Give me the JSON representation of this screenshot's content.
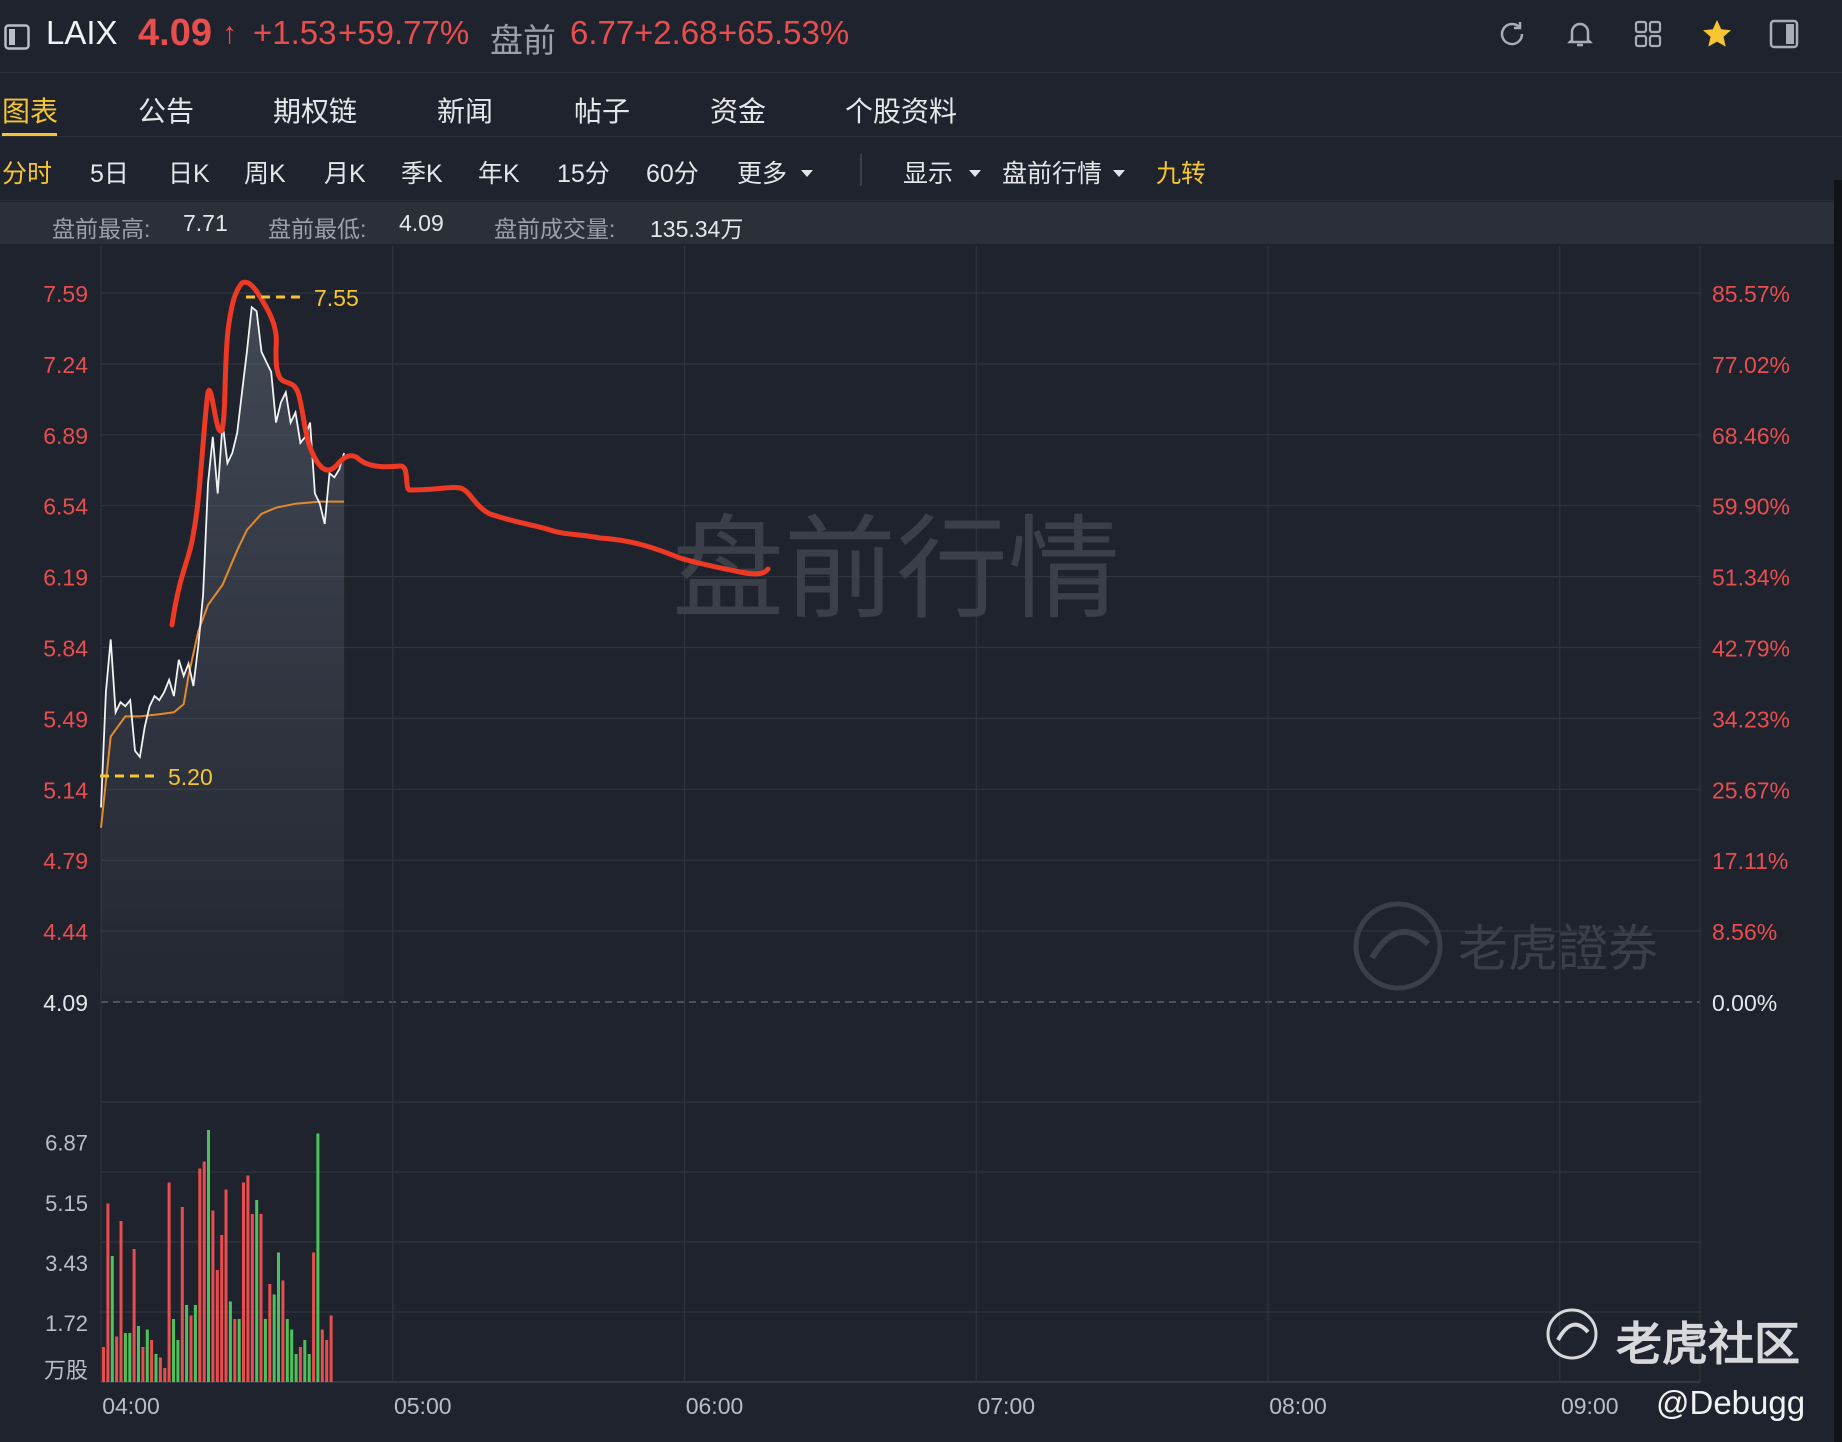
{
  "header": {
    "ticker": "LAIX",
    "price": "4.09",
    "arrow": "↑",
    "change": "+1.53",
    "change_pct": "+59.77%",
    "premarket_label": "盘前",
    "premarket_price": "6.77",
    "premarket_change": "+2.68",
    "premarket_change_pct": "+65.53%"
  },
  "tabs": [
    "图表",
    "公告",
    "期权链",
    "新闻",
    "帖子",
    "资金",
    "个股资料"
  ],
  "periods": [
    "分时",
    "5日",
    "日K",
    "周K",
    "月K",
    "季K",
    "年K",
    "15分",
    "60分",
    "更多"
  ],
  "tools": {
    "display": "显示",
    "premarket": "盘前行情",
    "nine_turn": "九转"
  },
  "stats": {
    "high_label": "盘前最高:",
    "high": "7.71",
    "low_label": "盘前最低:",
    "low": "4.09",
    "volume_label": "盘前成交量:",
    "volume": "135.34万"
  },
  "watermark": "盘前行情",
  "brand_watermark": "老虎證券",
  "community": "老虎社区",
  "credit": "@Debugg",
  "annotations": {
    "high_marker": "7.55",
    "low_marker": "5.20"
  },
  "colors": {
    "up": "#e84e4e",
    "down": "#4cc35a",
    "accent": "#f5c533",
    "avg_line": "#e48a2e",
    "annotation": "#ee3a25"
  },
  "chart_data": [
    {
      "type": "line",
      "y_ticks_left": [
        "7.59",
        "7.24",
        "6.89",
        "6.54",
        "6.19",
        "5.84",
        "5.49",
        "5.14",
        "4.79",
        "4.44",
        "4.09"
      ],
      "y_ticks_right": [
        "85.57%",
        "77.02%",
        "68.46%",
        "59.90%",
        "51.34%",
        "42.79%",
        "34.23%",
        "25.67%",
        "17.11%",
        "8.56%",
        "0.00%"
      ],
      "x_ticks": [
        "04:00",
        "05:00",
        "06:00",
        "07:00",
        "08:00",
        "09:00"
      ],
      "ylim": [
        4.09,
        7.59
      ],
      "base_price": 4.09,
      "series": [
        {
          "x": [
            "04:00",
            "04:01",
            "04:02",
            "04:03",
            "04:04",
            "04:05",
            "04:06",
            "04:07",
            "04:08",
            "04:09",
            "04:10",
            "04:11",
            "04:12",
            "04:13",
            "04:14",
            "04:15",
            "04:16",
            "04:17",
            "04:18",
            "04:19",
            "04:20",
            "04:21",
            "04:22",
            "04:23",
            "04:24",
            "04:25",
            "04:26",
            "04:27",
            "04:28",
            "04:29",
            "04:30",
            "04:31",
            "04:32",
            "04:33",
            "04:34",
            "04:35",
            "04:36",
            "04:37",
            "04:38",
            "04:39",
            "04:40",
            "04:41",
            "04:42",
            "04:43",
            "04:44",
            "04:45",
            "04:46",
            "04:47",
            "04:48",
            "04:49",
            "04:50"
          ],
          "values": [
            5.05,
            5.62,
            5.88,
            5.52,
            5.57,
            5.55,
            5.58,
            5.33,
            5.3,
            5.45,
            5.55,
            5.6,
            5.58,
            5.62,
            5.68,
            5.6,
            5.78,
            5.7,
            5.76,
            5.65,
            5.85,
            6.1,
            6.65,
            6.88,
            6.6,
            6.95,
            6.75,
            6.8,
            6.9,
            7.1,
            7.3,
            7.52,
            7.5,
            7.3,
            7.25,
            7.2,
            6.95,
            7.05,
            7.1,
            6.95,
            7.0,
            6.85,
            6.88,
            6.95,
            6.6,
            6.55,
            6.45,
            6.7,
            6.68,
            6.72,
            6.8
          ]
        },
        {
          "x": [
            "04:00",
            "04:02",
            "04:05",
            "04:08",
            "04:12",
            "04:15",
            "04:17",
            "04:18",
            "04:20",
            "04:22",
            "04:25",
            "04:28",
            "04:30",
            "04:33",
            "04:36",
            "04:40",
            "04:45",
            "04:50"
          ],
          "values": [
            4.95,
            5.4,
            5.5,
            5.5,
            5.51,
            5.52,
            5.56,
            5.7,
            5.92,
            6.05,
            6.15,
            6.32,
            6.42,
            6.5,
            6.53,
            6.55,
            6.56,
            6.56
          ]
        }
      ]
    },
    {
      "type": "bar",
      "y_ticks": [
        "6.87",
        "5.15",
        "3.43",
        "1.72"
      ],
      "unit": "万股",
      "ylim": [
        0,
        8.0
      ],
      "x_start": "04:00",
      "values": [
        1.0,
        5.1,
        3.6,
        1.3,
        4.6,
        1.4,
        1.4,
        3.8,
        1.6,
        1.0,
        1.5,
        1.2,
        0.8,
        0.7,
        0.4,
        5.7,
        1.8,
        1.2,
        5.0,
        2.2,
        1.9,
        2.2,
        6.1,
        6.3,
        7.2,
        4.9,
        3.2,
        4.2,
        5.5,
        2.3,
        1.8,
        1.8,
        5.7,
        5.9,
        4.8,
        5.2,
        4.8,
        1.8,
        2.8,
        2.5,
        3.7,
        2.9,
        1.8,
        1.5,
        0.8,
        1.0,
        1.2,
        0.8,
        3.7,
        7.1,
        1.5,
        1.2,
        1.9
      ],
      "colors_up_down": [
        "up",
        "up",
        "down",
        "up",
        "up",
        "down",
        "down",
        "up",
        "down",
        "up",
        "down",
        "up",
        "down",
        "up",
        "up",
        "up",
        "down",
        "down",
        "up",
        "down",
        "up",
        "down",
        "up",
        "up",
        "down",
        "up",
        "up",
        "up",
        "up",
        "down",
        "up",
        "down",
        "up",
        "up",
        "up",
        "down",
        "up",
        "down",
        "up",
        "down",
        "down",
        "up",
        "down",
        "down",
        "down",
        "up",
        "down",
        "down",
        "up",
        "down",
        "up",
        "up",
        "up"
      ]
    }
  ]
}
